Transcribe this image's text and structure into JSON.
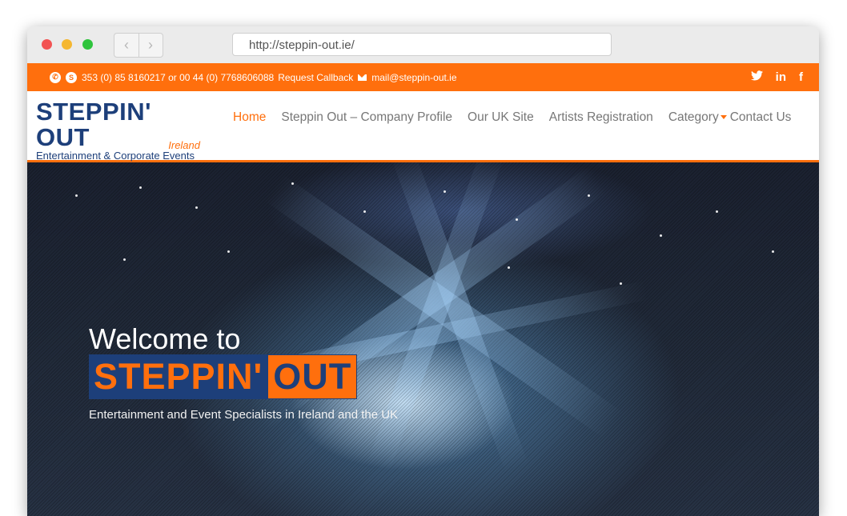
{
  "browser": {
    "url": "http://steppin-out.ie/",
    "back_glyph": "‹",
    "forward_glyph": "›"
  },
  "topbar": {
    "phone_icon": "phone-icon",
    "skype_icon": "skype-icon",
    "phone_text": "353 (0) 85 8160217 or 00 44 (0) 7768606088",
    "callback_text": "Request Callback",
    "mail_icon": "envelope-icon",
    "email": "mail@steppin-out.ie",
    "social": {
      "twitter_glyph": "🐦",
      "linkedin_glyph": "in",
      "facebook_glyph": "f"
    },
    "accent_color": "#ff6f0d"
  },
  "header": {
    "logo": {
      "title": "STEPPIN' OUT",
      "subtitle": "Entertainment & Corporate Events",
      "region": "Ireland"
    },
    "menu": [
      {
        "label": "Home",
        "active": true
      },
      {
        "label": "Steppin Out – Company Profile"
      },
      {
        "label": "Our UK Site"
      },
      {
        "label": "Artists Registration"
      },
      {
        "label": "Category"
      },
      {
        "label": "Contact Us"
      }
    ],
    "brand_color": "#1d3f7a"
  },
  "hero": {
    "welcome": "Welcome to",
    "brand_part1": "STEPPIN'",
    "brand_part2": "OUT",
    "tagline": "Entertainment and Event Specialists in Ireland and the UK"
  }
}
